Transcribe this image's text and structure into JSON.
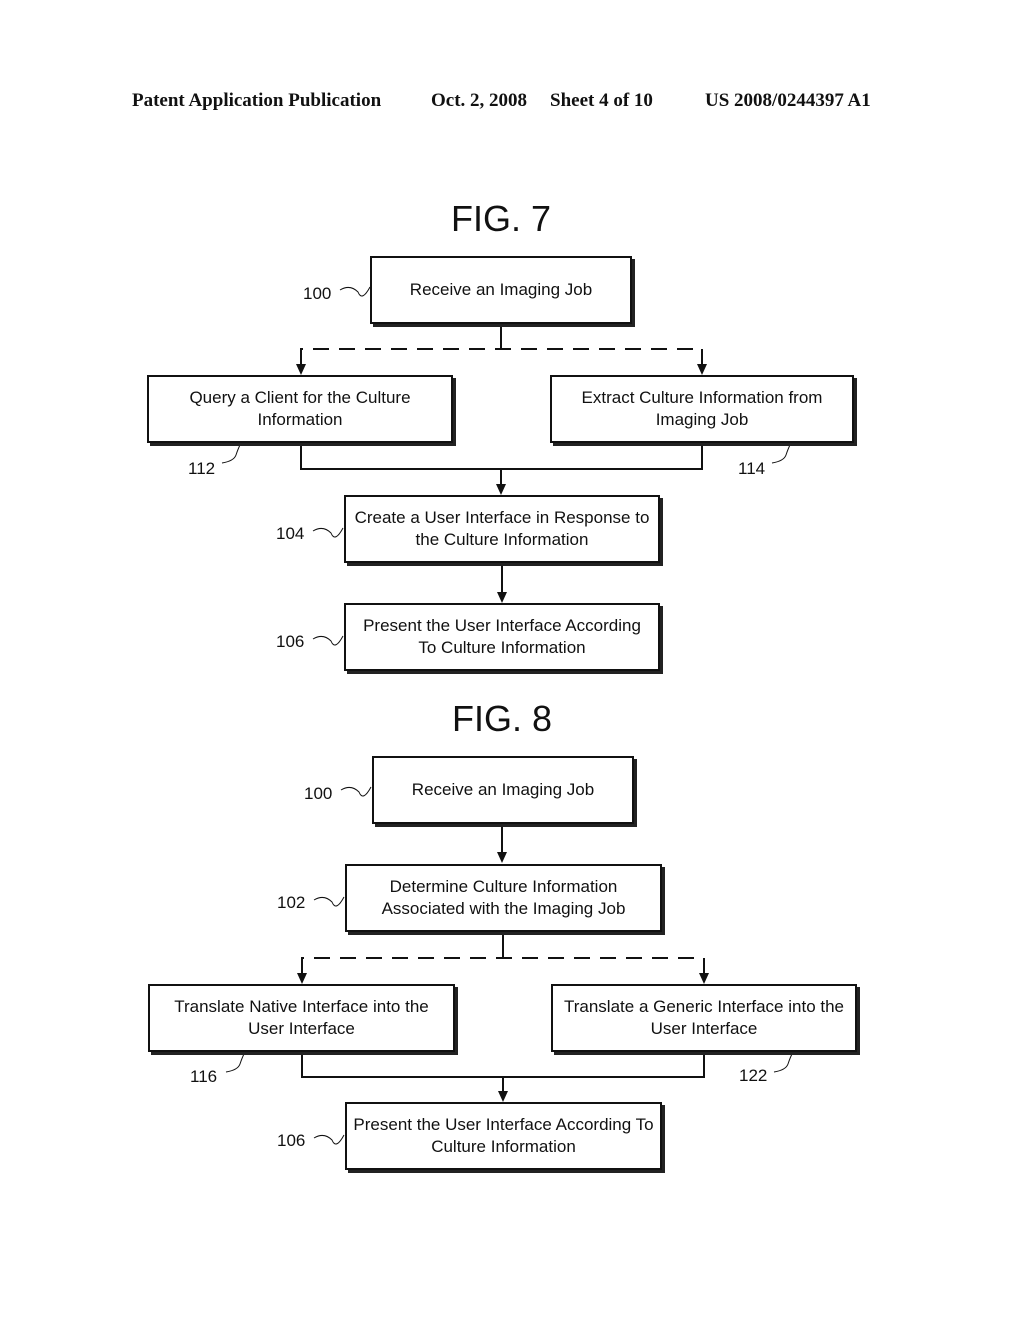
{
  "header": {
    "publication": "Patent Application Publication",
    "date": "Oct. 2, 2008",
    "sheet": "Sheet 4 of 10",
    "number": "US 2008/0244397 A1"
  },
  "fig7": {
    "title": "FIG. 7",
    "steps": {
      "s100": {
        "ref": "100",
        "text": "Receive an Imaging Job"
      },
      "s112": {
        "ref": "112",
        "text": "Query a Client for the Culture Information"
      },
      "s114": {
        "ref": "114",
        "text": "Extract Culture Information from Imaging Job"
      },
      "s104": {
        "ref": "104",
        "text": "Create a User Interface in Response to the Culture Information"
      },
      "s106": {
        "ref": "106",
        "text": "Present the User Interface According To Culture Information"
      }
    }
  },
  "fig8": {
    "title": "FIG. 8",
    "steps": {
      "s100": {
        "ref": "100",
        "text": "Receive an Imaging Job"
      },
      "s102": {
        "ref": "102",
        "text": "Determine Culture Information Associated with the Imaging Job"
      },
      "s116": {
        "ref": "116",
        "text": "Translate Native Interface into the User Interface"
      },
      "s122": {
        "ref": "122",
        "text": "Translate a Generic Interface into the User Interface"
      },
      "s106": {
        "ref": "106",
        "text": "Present the User Interface According To Culture Information"
      }
    }
  }
}
